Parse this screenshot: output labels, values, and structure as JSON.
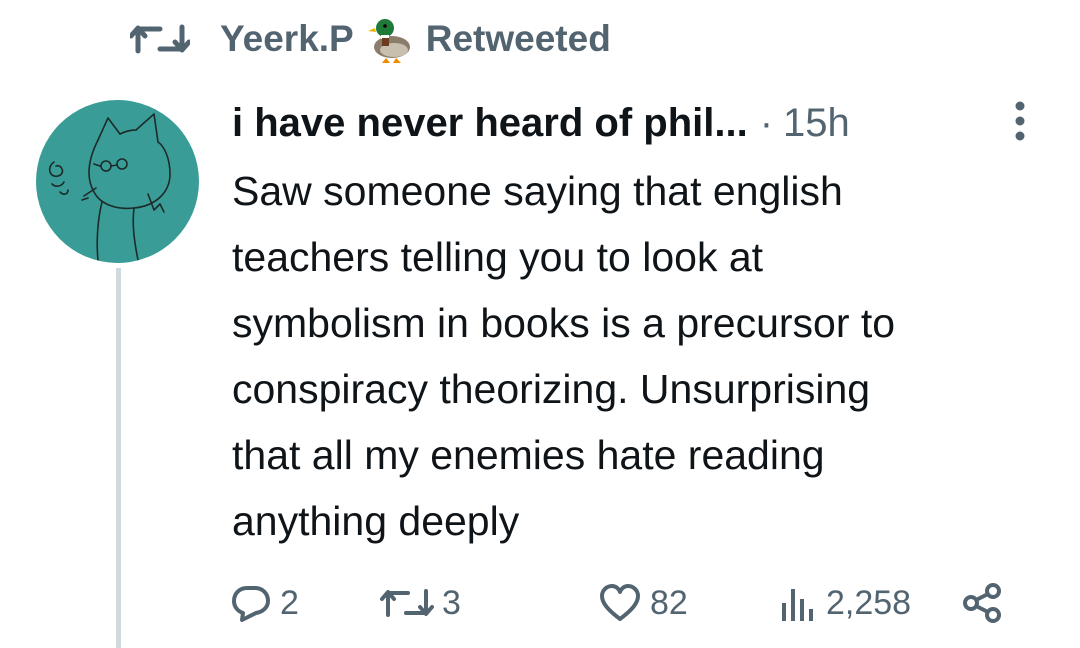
{
  "social_context": {
    "name": "Yeerk.P",
    "emoji_icon": "duck-emoji",
    "action": "Retweeted"
  },
  "tweet": {
    "display_name": "i have never heard of phil...",
    "separator": "·",
    "timestamp": "15h",
    "text": "Saw someone saying that english\nteachers telling you to look at\nsymbolism in books is a precursor to\nconspiracy theorizing. Unsurprising\nthat all my enemies hate reading\nanything deeply",
    "avatar_color": "#3a9c96",
    "avatar_description_icon": "cat-drawing-avatar"
  },
  "actions": {
    "reply_count": "2",
    "retweet_count": "3",
    "like_count": "82",
    "view_count": "2,258"
  },
  "colors": {
    "text_primary": "#0f1419",
    "text_secondary": "#536471",
    "thread_line": "#cfd9de"
  }
}
